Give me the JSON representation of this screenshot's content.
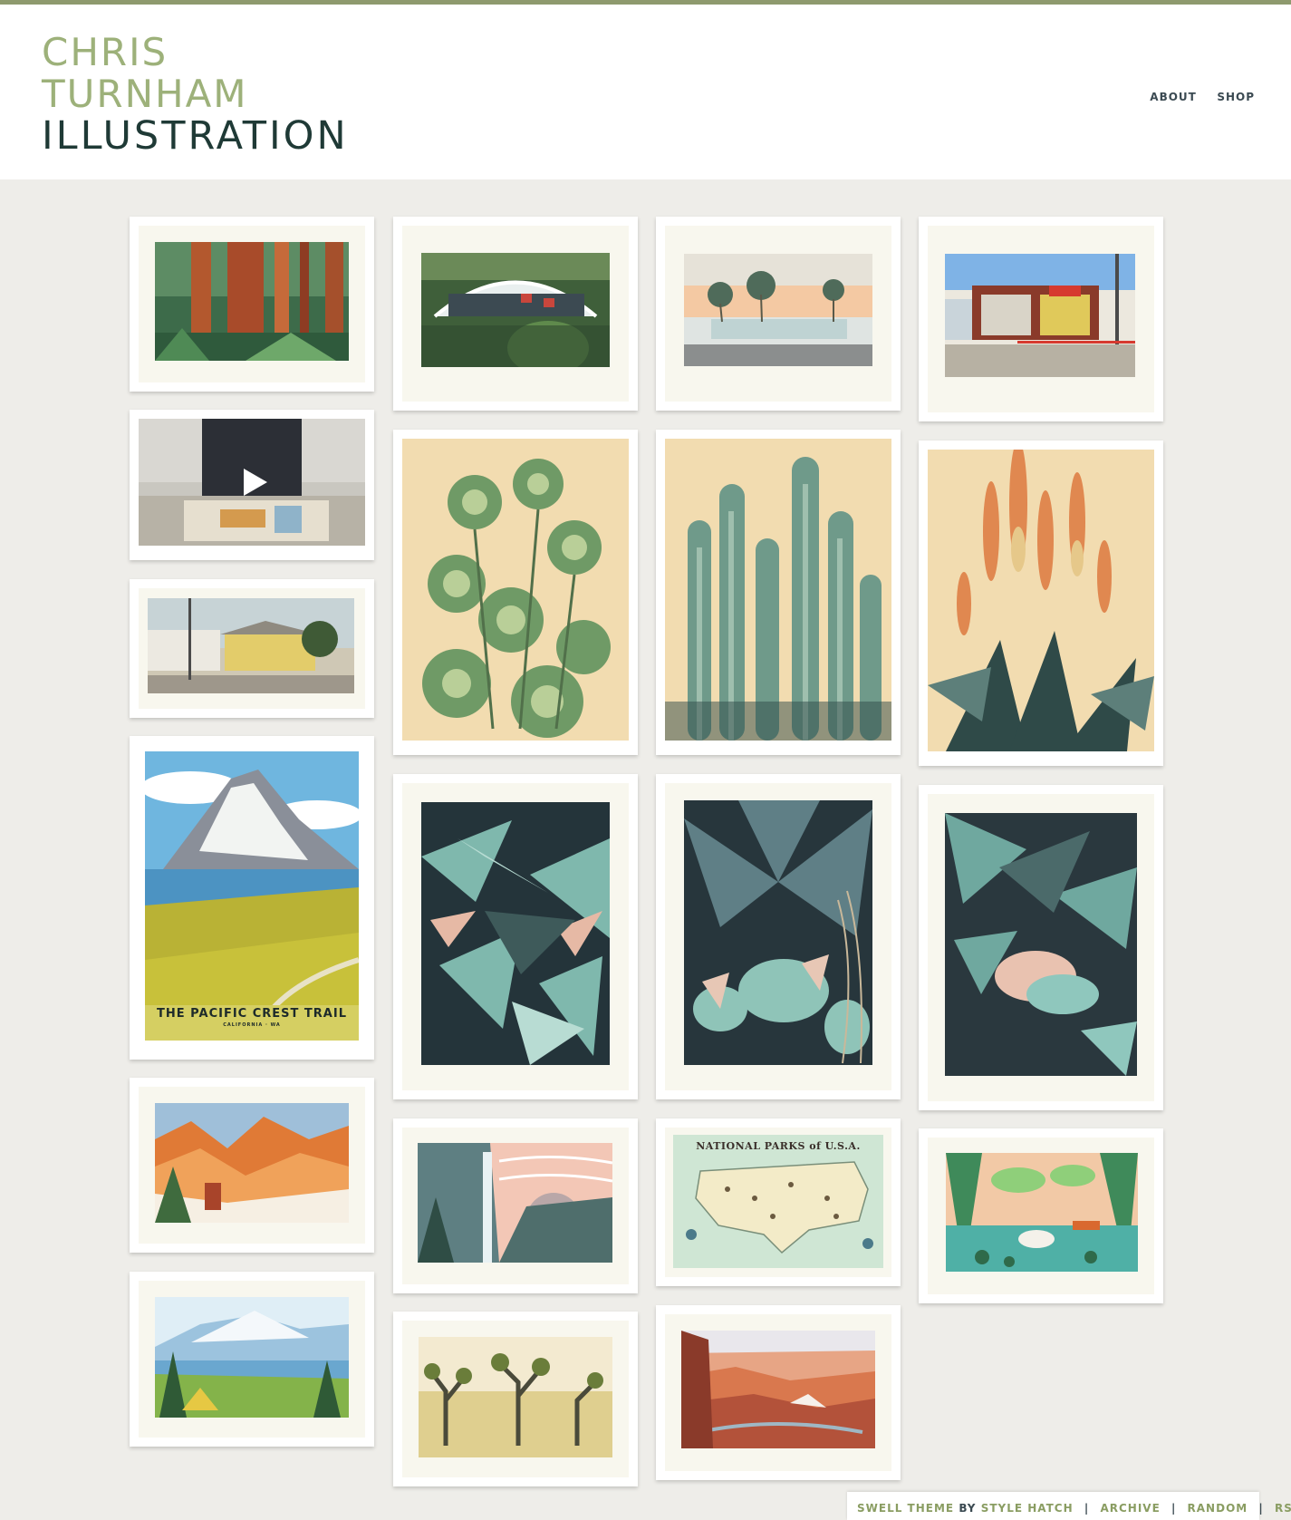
{
  "logo": {
    "line1": "CHRIS",
    "line2": "TURNHAM",
    "line3": "ILLUSTRATION"
  },
  "nav": {
    "about": "ABOUT",
    "shop": "SHOP"
  },
  "posts": {
    "pct_title": "THE PACIFIC CREST TRAIL",
    "pct_sub": "CALIFORNIA · WA",
    "map_title": "NATIONAL PARKS of U.S.A."
  },
  "footer": {
    "theme": "SWELL THEME",
    "by": "BY",
    "author": "STYLE HATCH",
    "archive": "ARCHIVE",
    "random": "RANDOM",
    "rss": "RSS",
    "sep": "|"
  },
  "colors": {
    "accent": "#8e9a6e",
    "logo_light": "#9db17a",
    "logo_dark": "#1f3a36",
    "background": "#eeede9"
  },
  "icons": {
    "play": "play-icon"
  }
}
